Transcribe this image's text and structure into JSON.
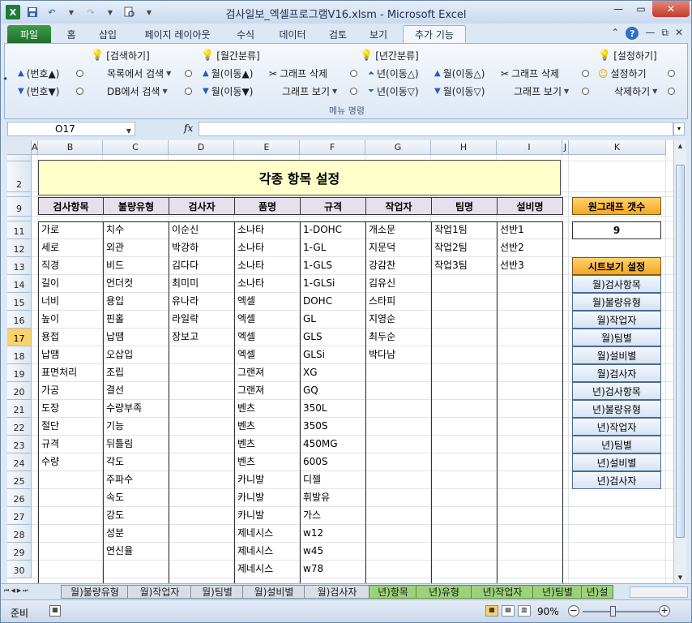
{
  "window": {
    "title": "검사일보_엑셀프로그램V16.xlsm  -  Microsoft Excel"
  },
  "ribbon_tabs": [
    "파일",
    "홈",
    "삽입",
    "페이지 레이아웃",
    "수식",
    "데이터",
    "검토",
    "보기",
    "추가 기능"
  ],
  "ribbon": {
    "search_header": "[검색하기]",
    "monthly_header": "[월간분류]",
    "yearly_header": "[년간분류]",
    "settings_header": "[설정하기]",
    "num_up": "(번호▲)",
    "num_down": "(번호▼)",
    "search_list": "목록에서 검색",
    "search_db": "DB에서 검색",
    "month_move_up": "월(이동▲)",
    "month_move_down": "월(이동▼)",
    "graph_delete_1": "그래프 삭제",
    "graph_view_1": "그래프 보기",
    "year_move_up": "년(이동△)",
    "year_move_down": "년(이동▽)",
    "month_move_up2": "월(이동△)",
    "month_move_down2": "월(이동▽)",
    "graph_delete_2": "그래프 삭제",
    "graph_view_2": "그래프 보기",
    "setup": "설정하기",
    "delete": "삭제하기",
    "group_label": "메뉴 명령"
  },
  "formula_bar": {
    "name_box": "O17",
    "fx": "fx",
    "formula": ""
  },
  "columns": [
    "A",
    "B",
    "C",
    "D",
    "E",
    "F",
    "G",
    "H",
    "I",
    "J",
    "K"
  ],
  "rows": [
    "1",
    "2",
    "3",
    "9",
    "10",
    "11",
    "12",
    "13",
    "14",
    "15",
    "16",
    "17",
    "18",
    "19",
    "20",
    "21",
    "22",
    "23",
    "24",
    "25",
    "26",
    "27",
    "28",
    "29",
    "30"
  ],
  "sheet": {
    "banner": "각종 항목 설정",
    "headers": [
      "검사항목",
      "불량유형",
      "검사자",
      "품명",
      "규격",
      "작업자",
      "팀명",
      "설비명"
    ],
    "table": {
      "inspection_items": [
        "가로",
        "세로",
        "직경",
        "길이",
        "너비",
        "높이",
        "용접",
        "납땜",
        "표면처리",
        "가공",
        "도장",
        "절단",
        "규격",
        "수량"
      ],
      "defect_types": [
        "치수",
        "외관",
        "비드",
        "언더컷",
        "용입",
        "핀홀",
        "납땜",
        "오삽입",
        "조립",
        "결선",
        "수량부족",
        "기능",
        "뒤틀림",
        "각도",
        "주파수",
        "속도",
        "강도",
        "성분",
        "연신율"
      ],
      "inspectors": [
        "이순신",
        "박강하",
        "김다다",
        "최미미",
        "유나라",
        "라일락",
        "장보고"
      ],
      "product_names": [
        "소나타",
        "소나타",
        "소나타",
        "소나타",
        "엑셀",
        "엑셀",
        "엑셀",
        "엑셀",
        "그랜져",
        "그랜져",
        "벤츠",
        "벤츠",
        "벤츠",
        "벤츠",
        "카니발",
        "카니발",
        "카니발",
        "제네시스",
        "제네시스",
        "제네시스"
      ],
      "specs": [
        "1-DOHC",
        "1-GL",
        "1-GLS",
        "1-GLSi",
        "DOHC",
        "GL",
        "GLS",
        "GLSi",
        "XG",
        "GQ",
        "350L",
        "350S",
        "450MG",
        "600S",
        "디젤",
        "휘발유",
        "가스",
        "w12",
        "w45",
        "w78"
      ],
      "workers": [
        "개소문",
        "지문덕",
        "강감찬",
        "김유신",
        "스타피",
        "지영순",
        "최두순",
        "박다남"
      ],
      "teams": [
        "작업1팀",
        "작업2팀",
        "작업3팀"
      ],
      "equipment": [
        "선반1",
        "선반2",
        "선반3"
      ]
    },
    "graph_count_label": "원그래프 갯수",
    "graph_count_value": "9",
    "sheet_view_label": "시트보기 설정",
    "sheet_view_buttons": [
      "월)검사항목",
      "월)불량유형",
      "월)작업자",
      "월)팀별",
      "월)설비별",
      "월)검사자",
      "년)검사항목",
      "년)불량유형",
      "년)작업자",
      "년)팀별",
      "년)설비별",
      "년)검사자"
    ]
  },
  "sheet_tabs": [
    "월)불량유형",
    "월)작업자",
    "월)팀별",
    "월)설비별",
    "월)검사자",
    "년)항목",
    "년)유형",
    "년)작업자",
    "년)팀별",
    "년)설"
  ],
  "status": {
    "ready": "준비",
    "zoom": "90%"
  }
}
